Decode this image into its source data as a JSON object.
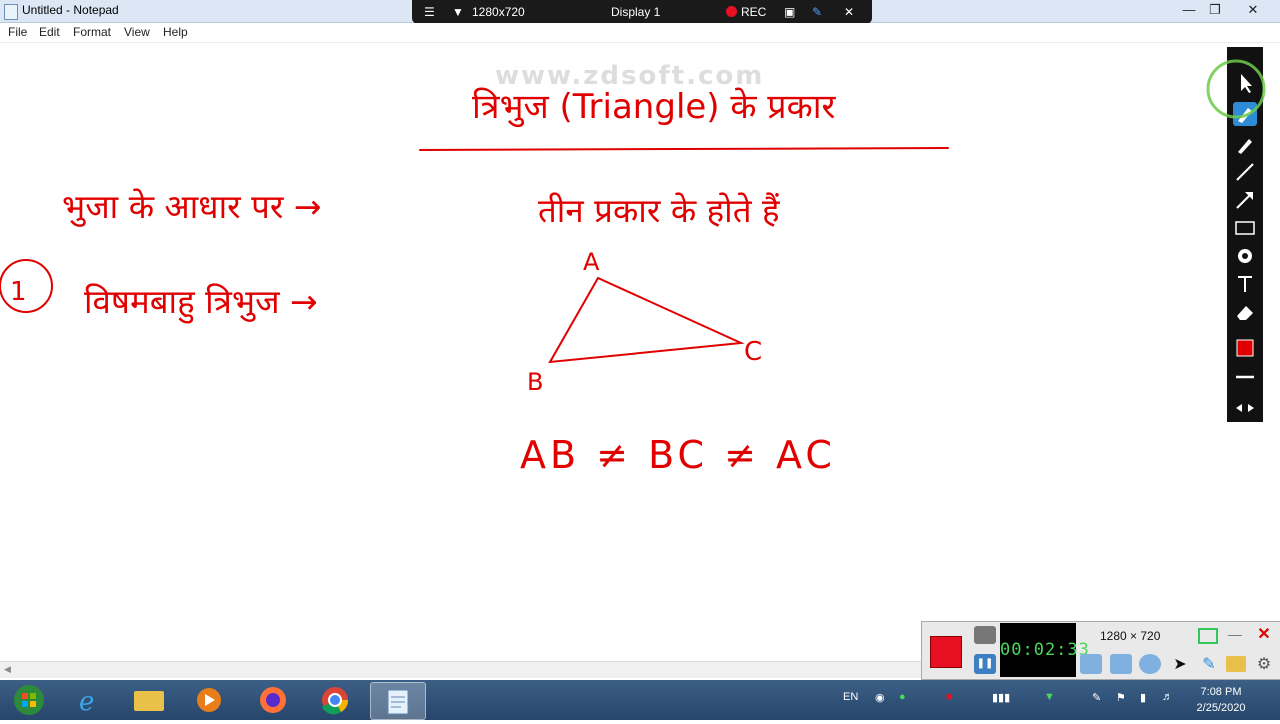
{
  "window": {
    "title": "Untitled - Notepad"
  },
  "recorder_bar": {
    "resolution": "1280x720",
    "display": "Display 1",
    "rec_label": "REC"
  },
  "menu": [
    {
      "label": "File"
    },
    {
      "label": "Edit"
    },
    {
      "label": "Format"
    },
    {
      "label": "View"
    },
    {
      "label": "Help"
    }
  ],
  "watermark": "www.zdsoft.com",
  "annotation_color": "#e00000",
  "drawing": {
    "heading": "त्रिभुज (Triangle) के प्रकार",
    "line1_left": "भुजा के आधार पर →",
    "line1_right": "तीन प्रकार के होते हैं",
    "item_number": "1",
    "item_label": "विषमबाहु त्रिभुज →",
    "vertex_a": "A",
    "vertex_b": "B",
    "vertex_c": "C",
    "relation": "AB ≠ BC ≠ AC"
  },
  "draw_toolbar": {
    "tools": [
      "cursor-icon",
      "highlighter-icon",
      "pen-icon",
      "line-icon",
      "arrow-icon",
      "rectangle-icon",
      "stamp-icon",
      "text-icon",
      "eraser-icon",
      "color-swatch",
      "line-width-icon",
      "expand-icon"
    ],
    "selected_color": "#e00000"
  },
  "recorder_panel": {
    "timer": "00:02:33",
    "resolution": "1280 × 720"
  },
  "taskbar": {
    "apps": [
      "start-orb",
      "internet-explorer",
      "file-explorer",
      "media-player",
      "firefox",
      "chrome",
      "notepad"
    ],
    "language": "EN",
    "time": "7:08 PM",
    "date": "2/25/2020"
  }
}
